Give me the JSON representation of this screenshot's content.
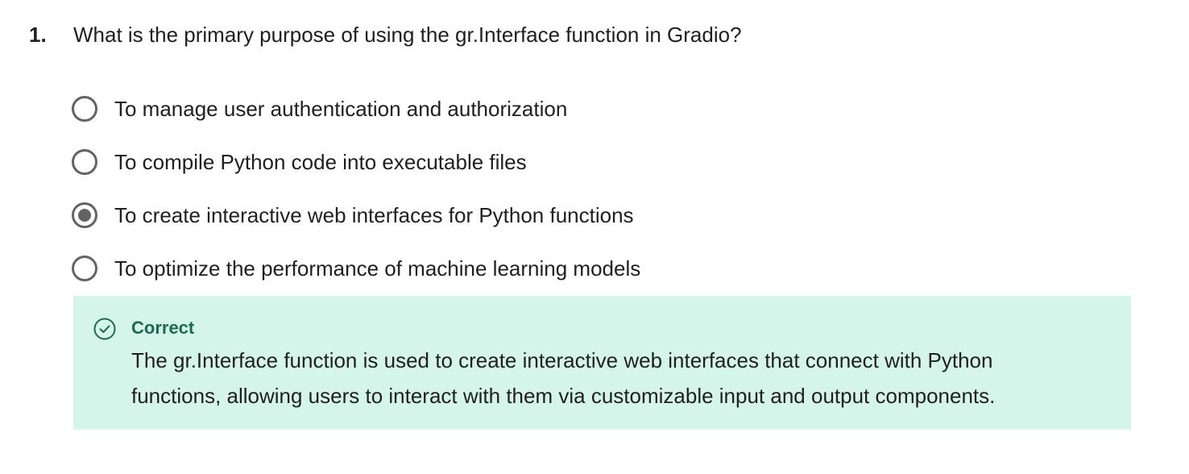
{
  "question": {
    "number": "1.",
    "text": "What is the primary purpose of using the gr.Interface function in Gradio?",
    "options": [
      {
        "label": "To manage user authentication and authorization",
        "selected": false
      },
      {
        "label": "To compile Python code into executable files",
        "selected": false
      },
      {
        "label": "To create interactive web interfaces for Python functions",
        "selected": true
      },
      {
        "label": "To optimize the performance of machine learning models",
        "selected": false
      }
    ]
  },
  "feedback": {
    "status": "Correct",
    "icon": "check-circle-icon",
    "color": "#1d6b4e",
    "background": "#d5f5eb",
    "line1": "The gr.Interface function is used to create interactive web interfaces that connect with Python",
    "line2": "functions, allowing users to interact with them via customizable input and output components."
  }
}
